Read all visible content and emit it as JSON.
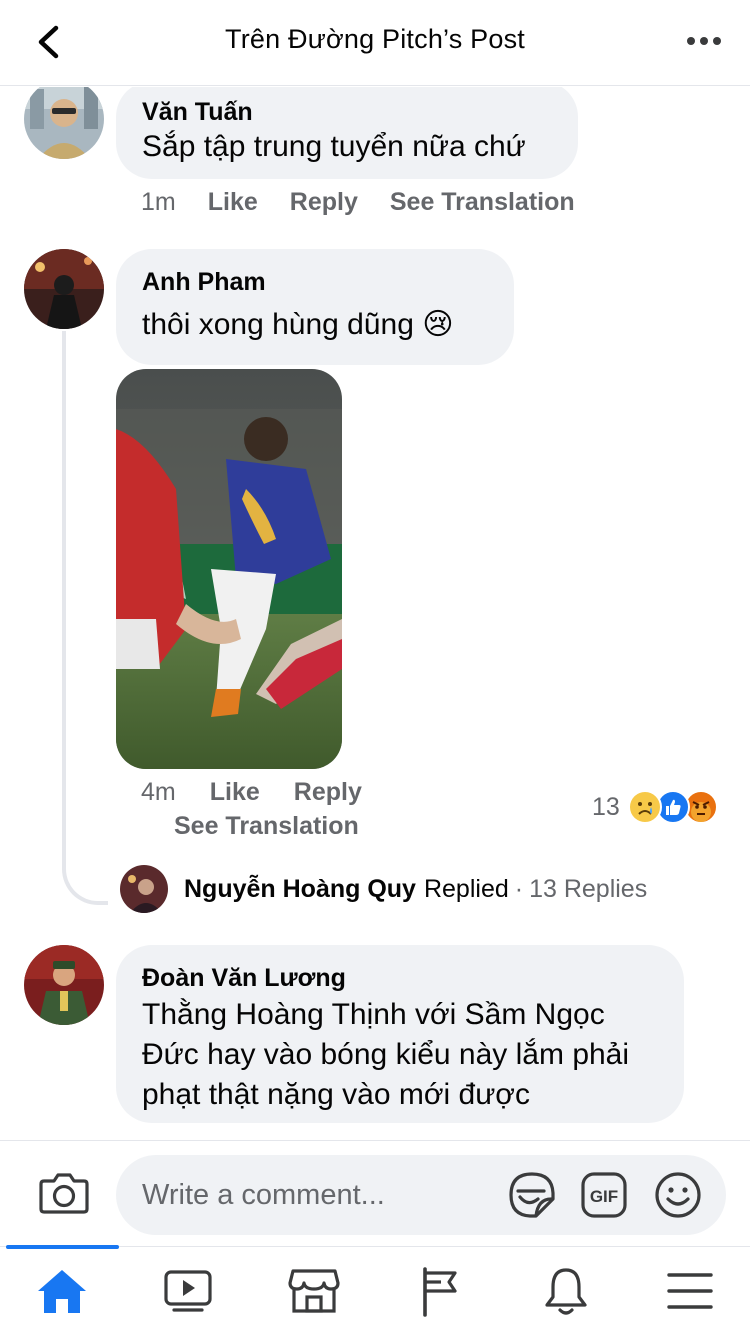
{
  "header": {
    "title": "Trên Đường Pitch’s Post"
  },
  "comments": [
    {
      "author": "Văn Tuấn",
      "text": "Sắp tập trung tuyển nữa chứ",
      "time": "1m",
      "like_label": "Like",
      "reply_label": "Reply",
      "translate_label": "See Translation"
    },
    {
      "author": "Anh Pham",
      "text": "thôi xong hùng dũng 😢",
      "time": "4m",
      "like_label": "Like",
      "reply_label": "Reply",
      "translate_label": "See Translation",
      "reaction_count": "13",
      "reactions": [
        "sad-icon",
        "like-icon",
        "angry-icon"
      ],
      "replied": {
        "name": "Nguyễn Hoàng Quy",
        "word": "Replied",
        "separator": "·",
        "count_label": "13 Replies"
      }
    },
    {
      "author": "Đoàn Văn Lương",
      "text_lines": [
        "Thằng Hoàng Thịnh với Sầm Ngọc",
        "Đức hay vào bóng kiểu này lắm phải",
        "phạt thật nặng vào mới được"
      ]
    }
  ],
  "composer": {
    "placeholder": "Write a comment...",
    "icons": [
      "camera-icon",
      "sticker-icon",
      "gif-icon",
      "emoji-icon"
    ]
  },
  "bottom_nav": {
    "items": [
      "home-icon",
      "watch-icon",
      "marketplace-icon",
      "pages-icon",
      "notifications-icon",
      "menu-icon"
    ],
    "active": "home-icon"
  },
  "colors": {
    "accent": "#1877f2",
    "bubble": "#f0f2f5",
    "secondary_text": "#65676b"
  }
}
